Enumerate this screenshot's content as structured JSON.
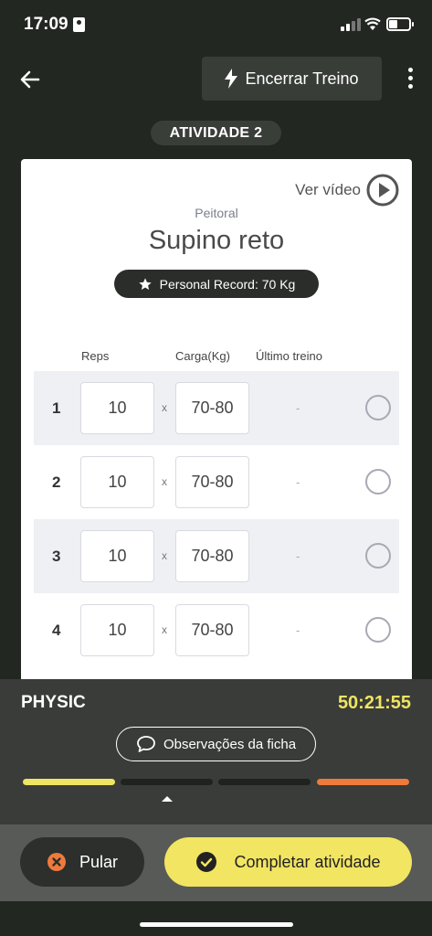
{
  "status_bar": {
    "time": "17:09"
  },
  "header": {
    "finish_label": "Encerrar Treino"
  },
  "activity_label": "ATIVIDADE 2",
  "exercise": {
    "video_label": "Ver vídeo",
    "muscle_group": "Peitoral",
    "name": "Supino reto",
    "personal_record": "Personal Record: 70 Kg"
  },
  "table": {
    "headers": {
      "reps": "Reps",
      "load": "Carga(Kg)",
      "last": "Último treino"
    },
    "times_symbol": "x",
    "rows": [
      {
        "set": "1",
        "reps": "10",
        "load": "70-80",
        "last": "-",
        "done": false
      },
      {
        "set": "2",
        "reps": "10",
        "load": "70-80",
        "last": "-",
        "done": false
      },
      {
        "set": "3",
        "reps": "10",
        "load": "70-80",
        "last": "-",
        "done": false
      },
      {
        "set": "4",
        "reps": "10",
        "load": "70-80",
        "last": "-",
        "done": false
      }
    ]
  },
  "footer": {
    "gym_name": "PHYSIC",
    "timer": "50:21:55",
    "notes_label": "Observações da ficha",
    "progress": [
      "#efe463",
      "#1f221f",
      "#1f221f",
      "#ee7a3c"
    ]
  },
  "actions": {
    "skip_label": "Pular",
    "complete_label": "Completar atividade"
  },
  "colors": {
    "accent_yellow": "#f2e562",
    "skip_red": "#ee7a3c",
    "background": "#232722"
  },
  "icons": {
    "back": "arrow-left-icon",
    "finish": "lightning-icon",
    "more": "more-vertical-icon",
    "video": "play-circle-icon",
    "record": "star-icon",
    "notes": "chat-bubble-icon",
    "skip": "close-circle-icon",
    "complete": "check-circle-icon"
  }
}
